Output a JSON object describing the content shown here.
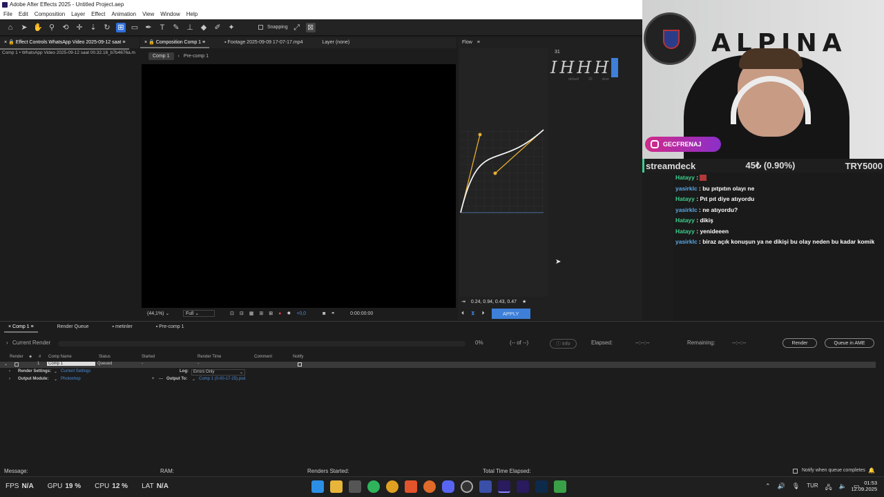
{
  "window": {
    "title": "Adobe After Effects 2025 - Untitled Project.aep"
  },
  "menu": [
    "File",
    "Edit",
    "Composition",
    "Layer",
    "Effect",
    "Animation",
    "View",
    "Window",
    "Help"
  ],
  "toolbar": {
    "snapping_label": "Snapping"
  },
  "effect_panel": {
    "tab": "Effect Controls WhatsApp Video 2025-09-12 saat",
    "breadcrumb": "Comp 1 • WhatsApp Video 2025-09-12 saat 00.32.16_b7b4676a.m"
  },
  "comp_panel": {
    "tab": "Composition Comp 1",
    "footage_tab": "Footage 2025-09-09 17-07-17.mp4",
    "layer_tab": "Layer (none)",
    "subtabs": [
      "Comp 1",
      "Pre-comp 1"
    ],
    "zoom": "(44,1%)",
    "resolution": "Full",
    "exposure": "+0,0",
    "timecode": "0:00:00:00"
  },
  "flow_panel": {
    "title": "Flow",
    "preset_count": "31",
    "preset_labels": [
      "",
      "default",
      "20",
      "slow"
    ],
    "curve_values": "0.24, 0.94, 0.43, 0.47",
    "apply_label": "APPLY"
  },
  "render_panel": {
    "tabs": [
      "Comp 1",
      "Render Queue",
      "metinler",
      "Pre-comp 1"
    ],
    "current_render_label": "Current Render",
    "progress": "0%",
    "of_label": "(-- of --)",
    "info_label": "Info",
    "elapsed_label": "Elapsed:",
    "elapsed_value": "--:--:--",
    "remaining_label": "Remaining:",
    "remaining_value": "--:--:--",
    "render_button": "Render",
    "queue_ame_button": "Queue in AME",
    "columns": [
      "Render",
      "#",
      "Comp Name",
      "Status",
      "Started",
      "Render Time",
      "Comment",
      "Notify"
    ],
    "row": {
      "index": "1",
      "comp_name": "Comp 1",
      "status": "Queued",
      "started": "-",
      "render_time": "-"
    },
    "render_settings_label": "Render Settings:",
    "render_settings_value": "Current Settings",
    "log_label": "Log:",
    "log_value": "Errors Only",
    "output_module_label": "Output Module:",
    "output_module_value": "Photoshop",
    "output_to_label": "Output To:",
    "output_to_value": "Comp 1 (0-00-17-25).psd",
    "message_label": "Message:",
    "ram_label": "RAM:",
    "renders_started_label": "Renders Started:",
    "total_elapsed_label": "Total Time Elapsed:",
    "notify_label": "Notify when queue completes"
  },
  "overlay": {
    "fps_label": "FPS",
    "fps_value": "N/A",
    "gpu_label": "GPU",
    "gpu_value": "19 %",
    "cpu_label": "CPU",
    "cpu_value": "12 %",
    "lat_label": "LAT",
    "lat_value": "N/A"
  },
  "webcam": {
    "brand": "ALPINA",
    "instagram": "GECFRENAJ",
    "ticker_name": "streamdeck",
    "ticker_value": "45₺ (0.90%)",
    "ticker_total": "TRY5000"
  },
  "chat": [
    {
      "user": "Hatayy",
      "message": "",
      "color": "#3ecf8e"
    },
    {
      "user": "yasirklc",
      "message": "bu pıtpıtın olayı ne",
      "color": "#5aa9e6"
    },
    {
      "user": "Hatayy",
      "message": "Pıt pıt diye atıyordu",
      "color": "#3ecf8e"
    },
    {
      "user": "yasirklc",
      "message": "ne atıyordu?",
      "color": "#5aa9e6"
    },
    {
      "user": "Hatayy",
      "message": "dikiş",
      "color": "#3ecf8e"
    },
    {
      "user": "Hatayy",
      "message": "yenideeen",
      "color": "#3ecf8e"
    },
    {
      "user": "yasirklc",
      "message": "biraz açık konuşun ya ne dikişi bu olay neden bu kadar komik",
      "color": "#5aa9e6"
    }
  ],
  "tray": {
    "language": "TUR",
    "time": "01:53",
    "date": "12.09.2025"
  },
  "colors": {
    "accent": "#2d6fd8",
    "curve": "#e8b030",
    "apply": "#3d7fd9"
  }
}
